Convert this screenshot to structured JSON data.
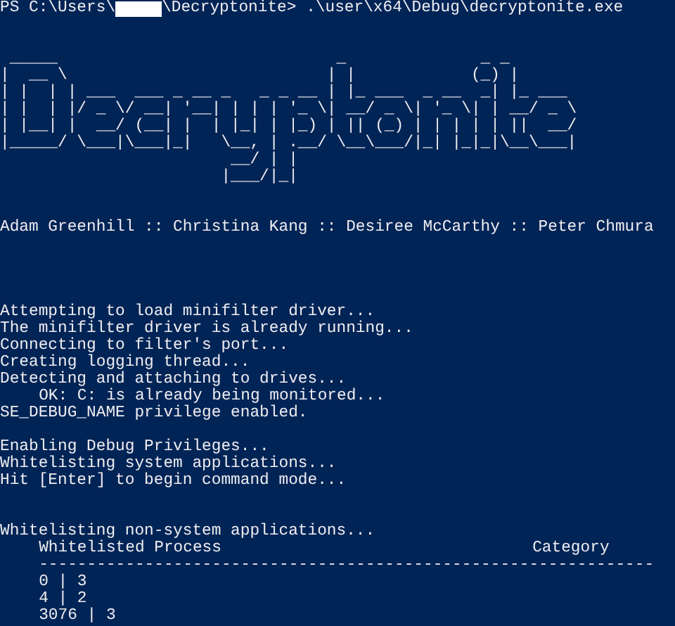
{
  "prompt": {
    "prefix": "PS C:\\Users\\",
    "suffix": "\\Decryptonite> .\\user\\x64\\Debug\\decryptonite.exe"
  },
  "banner": [
    " _____                             _              _ _       ",
    "|  __ \\                           | |            (_) |      ",
    "| |  | | ___  ___ _ __ _   _ _ __ | |_ ___  _ __  _| |_ ___ ",
    "| |  | |/ _ \\/ __| '__| | | | '_ \\| __/ _ \\| '_ \\| | __/ _ \\",
    "| |__| |  __/ (__| |  | |_| | |_) | || (_) | | | | | ||  __/",
    "|_____/ \\___|\\___|_|   \\__, | .__/ \\__\\___/|_| |_|_|\\__\\___|",
    "                        __/ | |                             ",
    "                       |___/|_|                             "
  ],
  "authors": "Adam Greenhill :: Christina Kang :: Desiree McCarthy :: Peter Chmura",
  "startup_log": [
    {
      "kind": "status",
      "text": "Attempting to load minifilter driver..."
    },
    {
      "kind": "status",
      "text": "The minifilter driver is already running..."
    },
    {
      "kind": "status",
      "text": "Connecting to filter's port..."
    },
    {
      "kind": "status",
      "text": "Creating logging thread..."
    },
    {
      "kind": "status",
      "text": "Detecting and attaching to drives..."
    },
    {
      "kind": "detail",
      "text": "OK: C: is already being monitored..."
    },
    {
      "kind": "status",
      "text": "SE_DEBUG_NAME privilege enabled."
    }
  ],
  "privilege_log": [
    "Enabling Debug Privileges...",
    "Whitelisting system applications...",
    "Hit [Enter] to begin command mode..."
  ],
  "whitelist": {
    "title": "Whitelisting non-system applications...",
    "columns": [
      "Whitelisted Process",
      "Category"
    ],
    "rule": "----------------------------------------------------------------",
    "rows": [
      "0 | 3",
      "4 | 2",
      "3076 | 3"
    ]
  }
}
